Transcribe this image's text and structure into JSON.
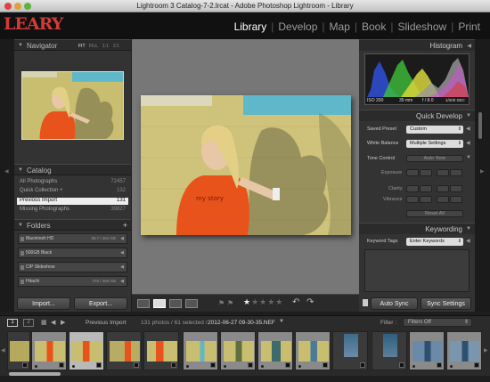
{
  "window": {
    "title": "Lightroom 3 Catalog-7-2.lrcat - Adobe Photoshop Lightroom - Library"
  },
  "identity_plate": {
    "logo_text": "LEARY"
  },
  "modules": [
    {
      "label": "Library",
      "active": true
    },
    {
      "label": "Develop"
    },
    {
      "label": "Map"
    },
    {
      "label": "Book"
    },
    {
      "label": "Slideshow"
    },
    {
      "label": "Print"
    }
  ],
  "navigator": {
    "title": "Navigator",
    "zoom": [
      "FIT",
      "FILL",
      "1:1",
      "2:1"
    ]
  },
  "catalog": {
    "title": "Catalog",
    "items": [
      {
        "label": "All Photographs",
        "count": "72457"
      },
      {
        "label": "Quick Collection +",
        "count": "132"
      },
      {
        "label": "Previous Import",
        "count": "131",
        "selected": true
      },
      {
        "label": "Missing Photographs",
        "count": "39827"
      }
    ]
  },
  "folders": {
    "title": "Folders",
    "add": "+",
    "items": [
      {
        "label": "Macintosh HD",
        "size": "38.7 / 464 GB"
      },
      {
        "label": "500GB Black",
        "size": ""
      },
      {
        "label": "CIP Slideshow",
        "size": ""
      },
      {
        "label": "Hitachi",
        "size": "378 / 465 GB"
      }
    ]
  },
  "left_buttons": {
    "import": "Import...",
    "export": "Export..."
  },
  "histogram": {
    "title": "Histogram",
    "info": {
      "iso": "ISO 200",
      "focal": "35 mm",
      "aperture": "f / 8.0",
      "shutter": "1/200 SEC"
    }
  },
  "quick_develop": {
    "title": "Quick Develop",
    "saved_preset_label": "Saved Preset",
    "saved_preset_value": "Custom",
    "white_balance_label": "White Balance",
    "white_balance_value": "Multiple Settings",
    "tone_control_label": "Tone Control",
    "auto_tone": "Auto Tone",
    "exposure": "Exposure",
    "clarity": "Clarity",
    "vibrance": "Vibrance",
    "reset_all": "Reset All"
  },
  "keywording": {
    "title": "Keywording",
    "keyword_tags_label": "Keyword Tags",
    "keyword_tags_value": "Enter Keywords"
  },
  "right_buttons": {
    "auto_sync": "Auto Sync",
    "sync_settings": "Sync Settings"
  },
  "toolbar": {
    "rating_stars": 5,
    "rating_value": 1
  },
  "filmstrip_bar": {
    "screen1": "1",
    "screen2": "2",
    "source": "Previous Import",
    "info": "131 photos / 61 selected /",
    "filename": "2012-06-27 09-30-35.NEF",
    "filter_label": "Filter :",
    "filter_value": "Filters Off"
  },
  "colors": {
    "accent": "#d23c37",
    "selected_row": "#eeeeee",
    "shirt": "#e8521b",
    "wall": "#cfc27a"
  }
}
